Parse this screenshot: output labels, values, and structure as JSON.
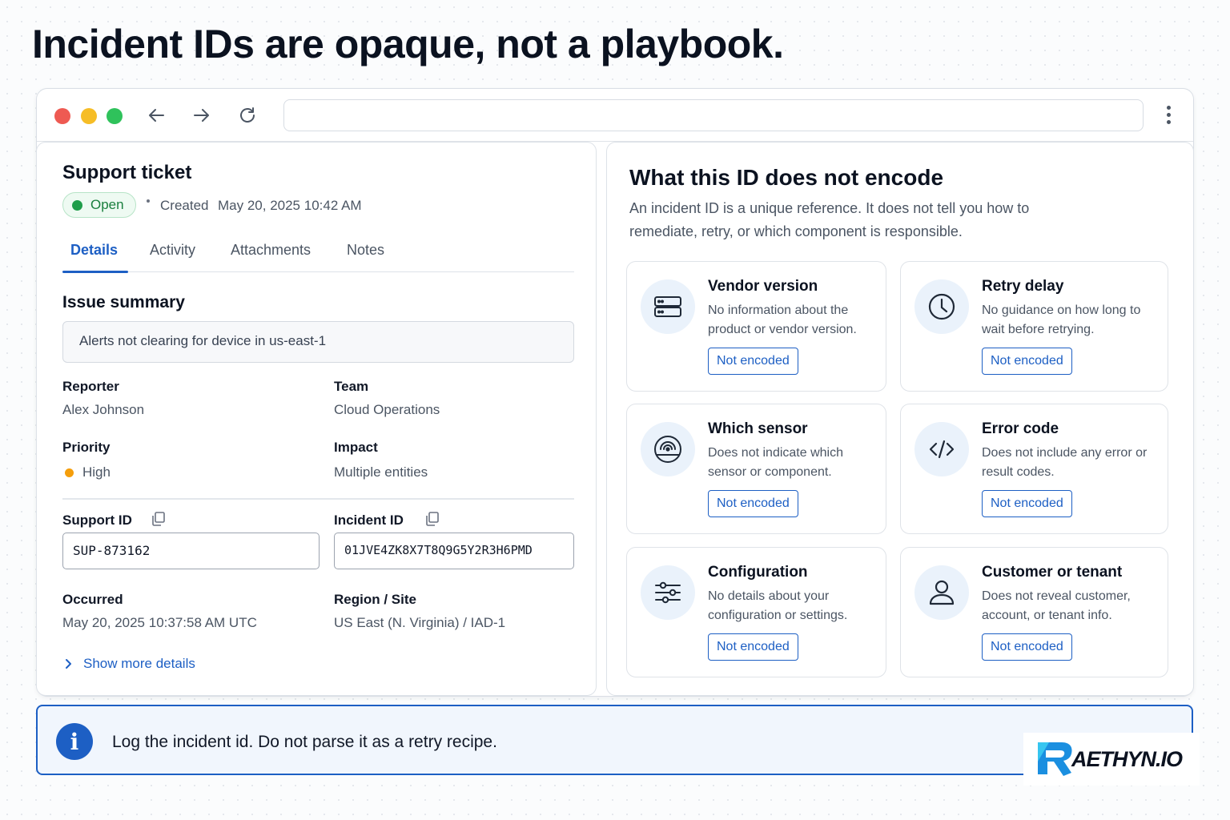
{
  "headline": "Incident IDs are opaque, not a playbook.",
  "ticket": {
    "title": "Support ticket",
    "status": "Open",
    "created_label": "Created",
    "created_value": "May 20, 2025 10:42 AM",
    "tabs": [
      {
        "label": "Details",
        "active": true
      },
      {
        "label": "Activity",
        "active": false
      },
      {
        "label": "Attachments",
        "active": false
      },
      {
        "label": "Notes",
        "active": false
      }
    ],
    "issue_summary_title": "Issue summary",
    "issue_summary_value": "Alerts not clearing for device in us-east-1",
    "reporter_label": "Reporter",
    "reporter_value": "Alex Johnson",
    "team_label": "Team",
    "team_value": "Cloud Operations",
    "priority_label": "Priority",
    "priority_value": "High",
    "impact_label": "Impact",
    "impact_value": "Multiple entities",
    "support_id_label": "Support ID",
    "support_id_value": "SUP-873162",
    "incident_id_label": "Incident ID",
    "incident_id_value": "01JVE4ZK8X7T8Q9G5Y2R3H6PMD",
    "occurred_label": "Occurred",
    "occurred_value": "May 20, 2025 10:37:58 AM UTC",
    "region_label": "Region / Site",
    "region_value": "US East (N. Virginia) / IAD-1",
    "show_more": "Show more details"
  },
  "encode_panel": {
    "title": "What this ID does not encode",
    "description": "An incident ID is a unique reference. It does not tell you how to remediate, retry, or which component is responsible.",
    "cards": [
      {
        "title": "Vendor version",
        "description": "No information about the product or vendor version.",
        "badge": "Not encoded",
        "icon": "server-icon"
      },
      {
        "title": "Retry delay",
        "description": "No guidance on how long to wait before retrying.",
        "badge": "Not encoded",
        "icon": "clock-icon"
      },
      {
        "title": "Which sensor",
        "description": "Does not indicate which sensor or component.",
        "badge": "Not encoded",
        "icon": "sensor-icon"
      },
      {
        "title": "Error code",
        "description": "Does not include any error or result codes.",
        "badge": "Not encoded",
        "icon": "code-icon"
      },
      {
        "title": "Configuration",
        "description": "No details about your configuration or settings.",
        "badge": "Not encoded",
        "icon": "sliders-icon"
      },
      {
        "title": "Customer or tenant",
        "description": "Does not reveal customer, account, or tenant info.",
        "badge": "Not encoded",
        "icon": "user-icon"
      }
    ]
  },
  "banner": {
    "icon": "info-icon",
    "message": "Log the incident id. Do not parse it as a retry recipe."
  },
  "logo": {
    "text": "AETHYN.IO"
  },
  "colors": {
    "accent": "#1d5fc4",
    "open_green": "#1f9d4a",
    "priority_high": "#f59e0b",
    "traffic_red": "#ee5a52",
    "traffic_yellow": "#f6bd26",
    "traffic_green": "#2fc25b"
  }
}
